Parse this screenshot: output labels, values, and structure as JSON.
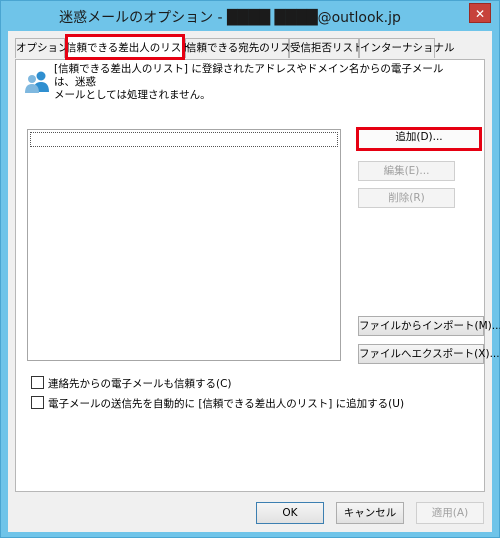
{
  "window": {
    "title": "迷惑メールのオプション - ████ ████@outlook.jp",
    "close_symbol": "✕"
  },
  "tabs": [
    {
      "label": "オプション"
    },
    {
      "label": "信頼できる差出人のリスト"
    },
    {
      "label": "信頼できる宛先のリスト"
    },
    {
      "label": "受信拒否リスト"
    },
    {
      "label": "インターナショナル"
    }
  ],
  "info": {
    "line1": "[信頼できる差出人のリスト] に登録されたアドレスやドメイン名からの電子メールは、迷惑",
    "line2": "メールとしては処理されません。",
    "icon": "people-icon"
  },
  "buttons": {
    "add": "追加(D)...",
    "edit": "編集(E)...",
    "delete": "削除(R)",
    "import": "ファイルからインポート(M)...",
    "export": "ファイルへエクスポート(X)..."
  },
  "checkboxes": {
    "trust_contacts": "連絡先からの電子メールも信頼する(C)",
    "auto_add": "電子メールの送信先を自動的に [信頼できる差出人のリスト] に追加する(U)"
  },
  "footer": {
    "ok": "OK",
    "cancel": "キャンセル",
    "apply": "適用(A)"
  },
  "colors": {
    "highlight": "#e60012",
    "title_bar": "#6fc4e9"
  }
}
